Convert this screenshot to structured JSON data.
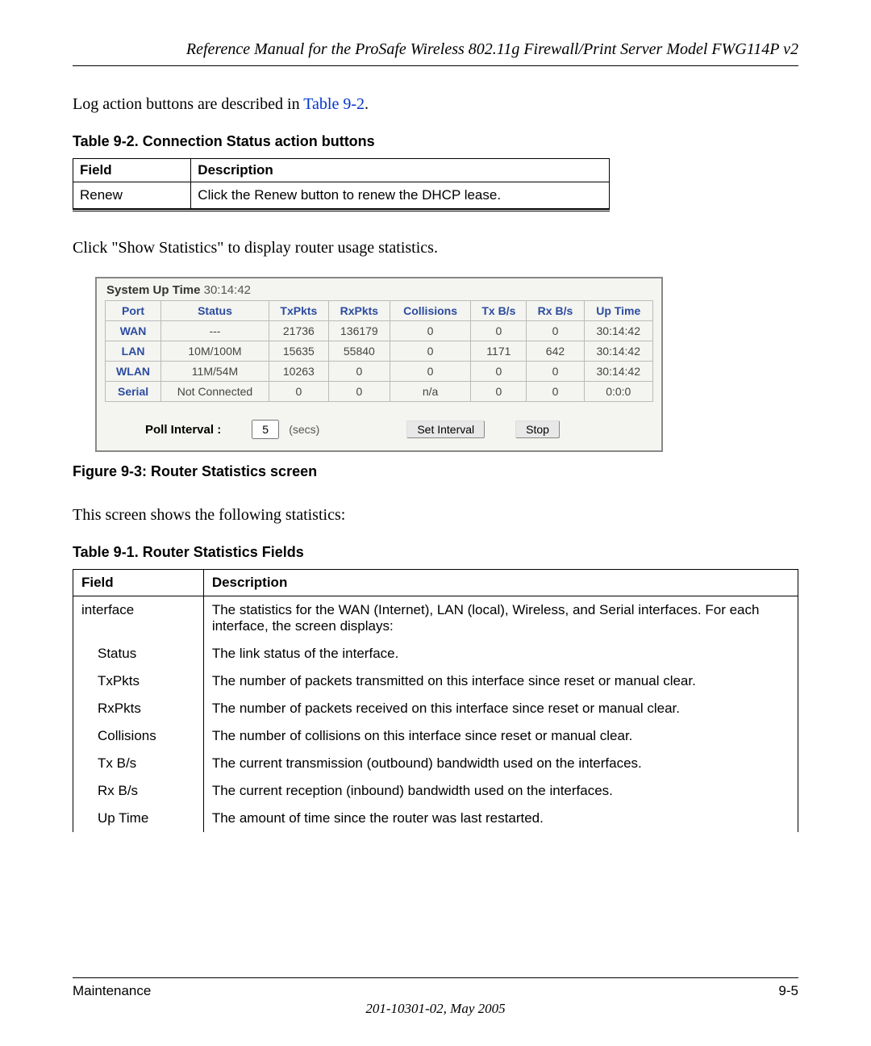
{
  "header": {
    "title": "Reference Manual for the ProSafe Wireless 802.11g  Firewall/Print Server Model FWG114P v2"
  },
  "intro_pre": "Log action buttons are described in ",
  "intro_link": "Table 9-2",
  "intro_post": ".",
  "table92": {
    "caption": "Table 9-2.        Connection Status action buttons",
    "head_field": "Field",
    "head_desc": "Description",
    "rows": [
      {
        "field": "Renew",
        "desc": "Click the Renew button to renew the DHCP lease."
      }
    ]
  },
  "click_stats": "Click \"Show Statistics\" to display router usage statistics.",
  "stats": {
    "sys_up_label": "System Up Time ",
    "sys_up_value": "30:14:42",
    "headers": [
      "Port",
      "Status",
      "TxPkts",
      "RxPkts",
      "Collisions",
      "Tx B/s",
      "Rx B/s",
      "Up Time"
    ],
    "rows": [
      {
        "port": "WAN",
        "status": "---",
        "tx": "21736",
        "rx": "136179",
        "col": "0",
        "txb": "0",
        "rxb": "0",
        "up": "30:14:42"
      },
      {
        "port": "LAN",
        "status": "10M/100M",
        "tx": "15635",
        "rx": "55840",
        "col": "0",
        "txb": "1171",
        "rxb": "642",
        "up": "30:14:42"
      },
      {
        "port": "WLAN",
        "status": "11M/54M",
        "tx": "10263",
        "rx": "0",
        "col": "0",
        "txb": "0",
        "rxb": "0",
        "up": "30:14:42"
      },
      {
        "port": "Serial",
        "status": "Not Connected",
        "tx": "0",
        "rx": "0",
        "col": "n/a",
        "txb": "0",
        "rxb": "0",
        "up": "0:0:0"
      }
    ],
    "poll_label": "Poll Interval :",
    "poll_value": "5",
    "secs": "(secs)",
    "btn_set": "Set Interval",
    "btn_stop": "Stop"
  },
  "figure_caption": "Figure 9-3:  Router Statistics screen",
  "stats_intro": "This screen shows the following statistics:",
  "table91": {
    "caption": "Table 9-1.        Router Statistics Fields",
    "head_field": "Field",
    "head_desc": "Description",
    "rows": [
      {
        "field": "interface",
        "desc": "The statistics for the WAN (Internet), LAN (local), Wireless, and Serial interfaces. For each interface, the screen displays:",
        "cls": "row-interface"
      },
      {
        "field": "Status",
        "desc": "The link status of the interface.",
        "cls": "sub"
      },
      {
        "field": "TxPkts",
        "desc": "The number of packets transmitted on this interface since reset or manual clear.",
        "cls": "sub"
      },
      {
        "field": "RxPkts",
        "desc": "The number of packets received on this interface since reset or manual clear.",
        "cls": "sub"
      },
      {
        "field": "Collisions",
        "desc": "The number of collisions on this interface since reset or manual clear.",
        "cls": "sub"
      },
      {
        "field": "Tx B/s",
        "desc": "The current transmission (outbound) bandwidth used on the interfaces.",
        "cls": "sub"
      },
      {
        "field": "Rx B/s",
        "desc": "The current reception (inbound) bandwidth used on the interfaces.",
        "cls": "sub"
      },
      {
        "field": "Up Time",
        "desc": "The amount of time since the router was last restarted.",
        "cls": "sub"
      }
    ]
  },
  "footer": {
    "left": "Maintenance",
    "right": "9-5",
    "sub": "201-10301-02, May 2005"
  }
}
